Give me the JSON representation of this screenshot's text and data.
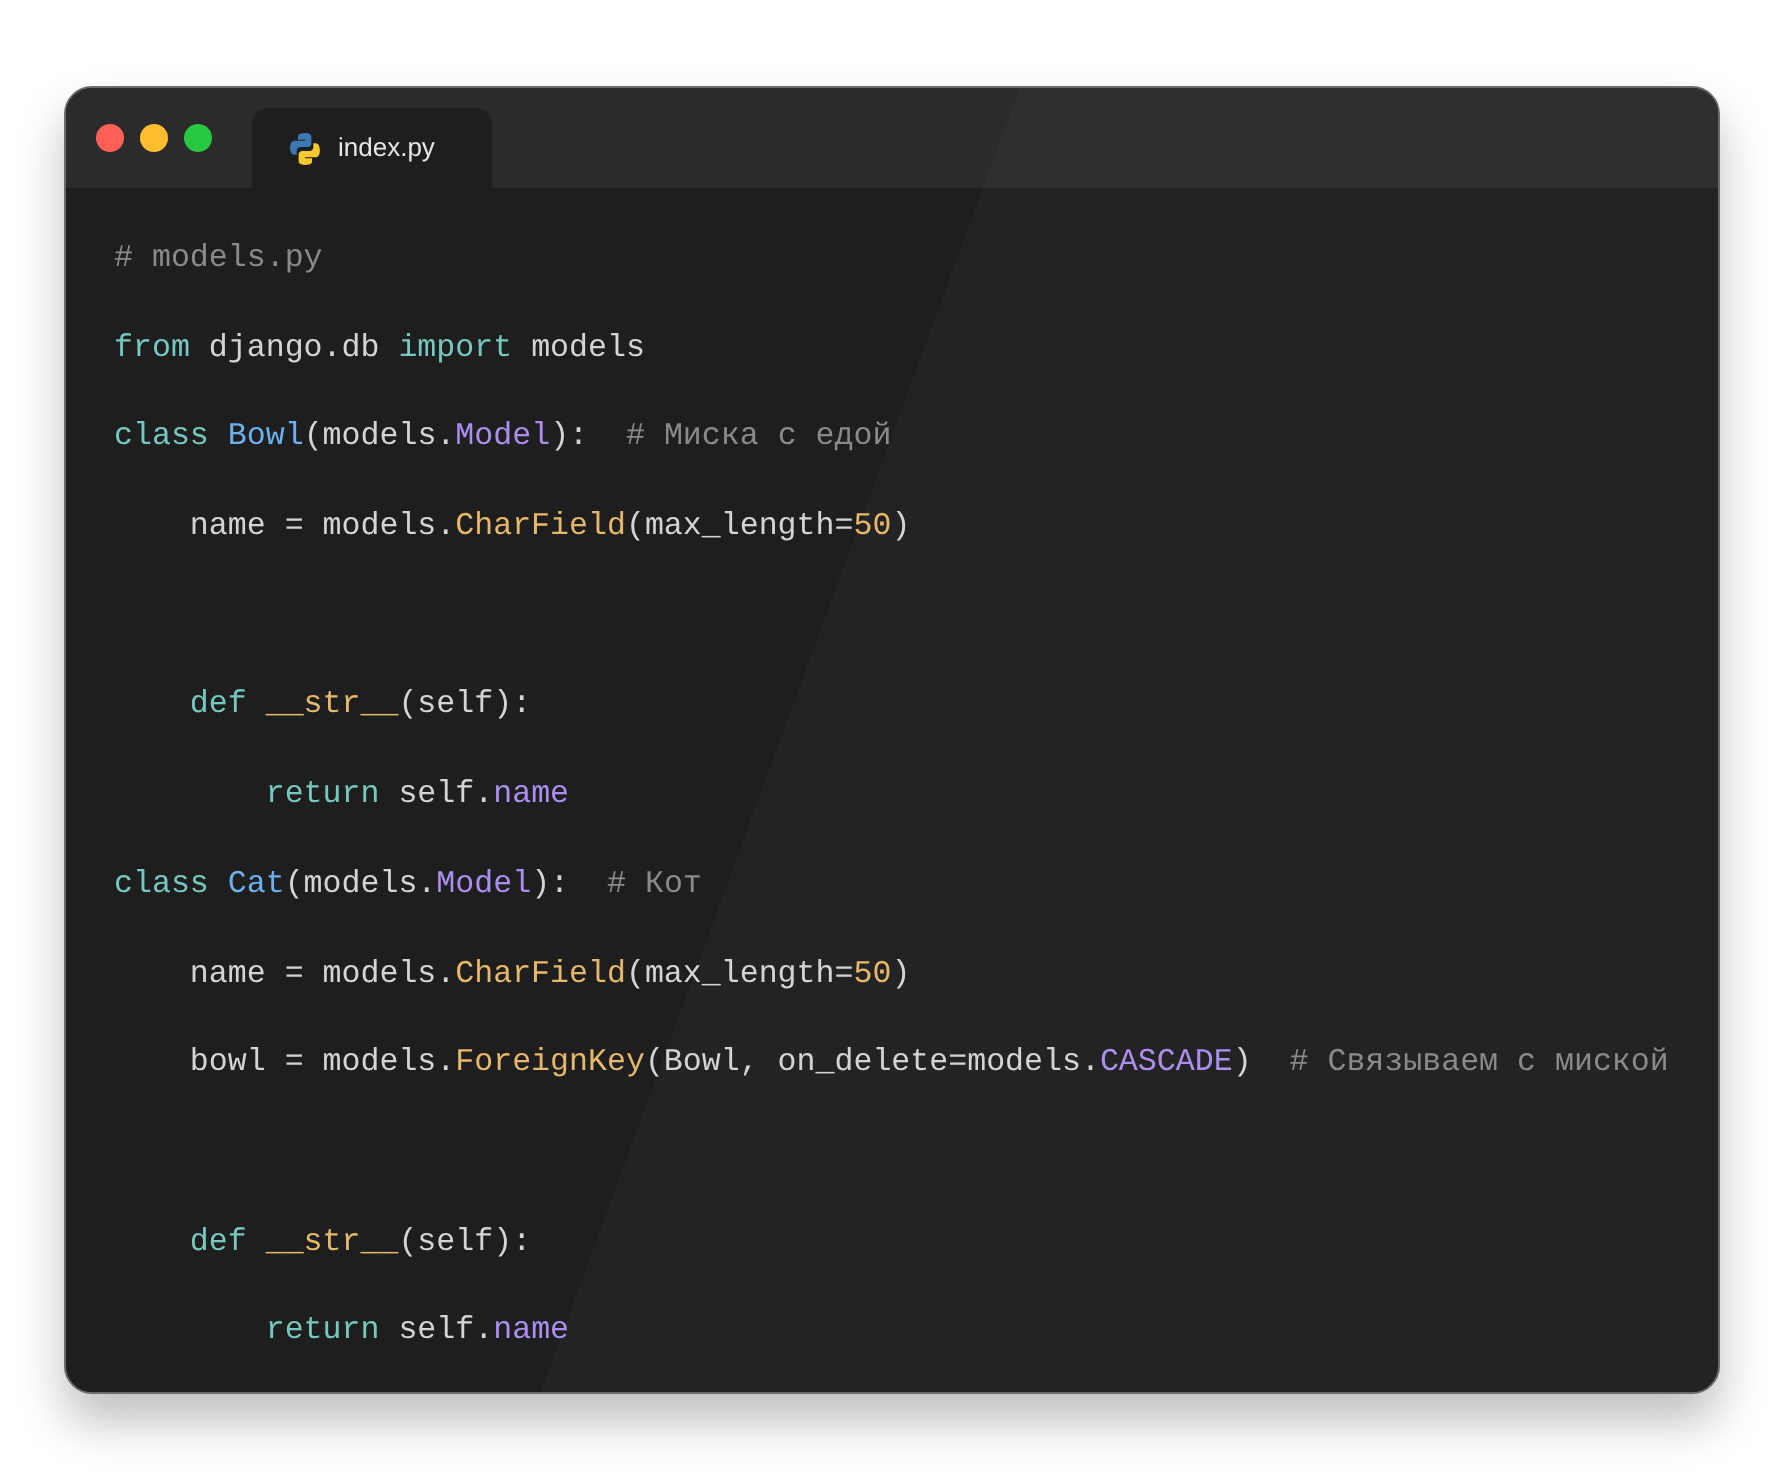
{
  "tab": {
    "title": "index.py",
    "selected": true
  },
  "lines": [
    {
      "kind": "code",
      "tokens": [
        {
          "kind": "comment",
          "text": "# models.py"
        }
      ]
    },
    {
      "kind": "code",
      "tokens": [
        {
          "kind": "keyword",
          "text": "from"
        },
        {
          "kind": "plain",
          "text": " django.db "
        },
        {
          "kind": "keyword",
          "text": "import"
        },
        {
          "kind": "plain",
          "text": " models"
        }
      ]
    },
    {
      "kind": "code",
      "tokens": [
        {
          "kind": "keyword",
          "text": "class"
        },
        {
          "kind": "class",
          "text": " Bowl"
        },
        {
          "kind": "plain",
          "text": "(models."
        },
        {
          "kind": "builtin",
          "text": "Model"
        },
        {
          "kind": "plain",
          "text": "):  "
        },
        {
          "kind": "comment",
          "text": "# Миска с едой"
        }
      ]
    },
    {
      "kind": "code",
      "tokens": [
        {
          "kind": "plain",
          "text": "    name = models."
        },
        {
          "kind": "call",
          "text": "CharField"
        },
        {
          "kind": "plain",
          "text": "(max_length="
        },
        {
          "kind": "number",
          "text": "50"
        },
        {
          "kind": "plain",
          "text": ")"
        }
      ]
    },
    {
      "kind": "blank"
    },
    {
      "kind": "code",
      "tokens": [
        {
          "kind": "keyword",
          "text": "    def"
        },
        {
          "kind": "call",
          "text": " __str__"
        },
        {
          "kind": "plain",
          "text": "(self):"
        }
      ]
    },
    {
      "kind": "code",
      "tokens": [
        {
          "kind": "keyword",
          "text": "        return"
        },
        {
          "kind": "plain",
          "text": " self."
        },
        {
          "kind": "builtin",
          "text": "name"
        }
      ]
    },
    {
      "kind": "code",
      "tokens": [
        {
          "kind": "keyword",
          "text": "class"
        },
        {
          "kind": "class",
          "text": " Cat"
        },
        {
          "kind": "plain",
          "text": "(models."
        },
        {
          "kind": "builtin",
          "text": "Model"
        },
        {
          "kind": "plain",
          "text": "):  "
        },
        {
          "kind": "comment",
          "text": "# Кот"
        }
      ]
    },
    {
      "kind": "code",
      "tokens": [
        {
          "kind": "plain",
          "text": "    name = models."
        },
        {
          "kind": "call",
          "text": "CharField"
        },
        {
          "kind": "plain",
          "text": "(max_length="
        },
        {
          "kind": "number",
          "text": "50"
        },
        {
          "kind": "plain",
          "text": ")"
        }
      ]
    },
    {
      "kind": "code",
      "tokens": [
        {
          "kind": "plain",
          "text": "    bowl = models."
        },
        {
          "kind": "call",
          "text": "ForeignKey"
        },
        {
          "kind": "plain",
          "text": "(Bowl, on_delete=models."
        },
        {
          "kind": "builtin",
          "text": "CASCADE"
        },
        {
          "kind": "plain",
          "text": ")  "
        },
        {
          "kind": "comment",
          "text": "# Связываем с миской"
        }
      ]
    },
    {
      "kind": "blank"
    },
    {
      "kind": "code",
      "tokens": [
        {
          "kind": "keyword",
          "text": "    def"
        },
        {
          "kind": "call",
          "text": " __str__"
        },
        {
          "kind": "plain",
          "text": "(self):"
        }
      ]
    },
    {
      "kind": "code",
      "tokens": [
        {
          "kind": "keyword",
          "text": "        return"
        },
        {
          "kind": "plain",
          "text": " self."
        },
        {
          "kind": "builtin",
          "text": "name"
        }
      ]
    }
  ]
}
